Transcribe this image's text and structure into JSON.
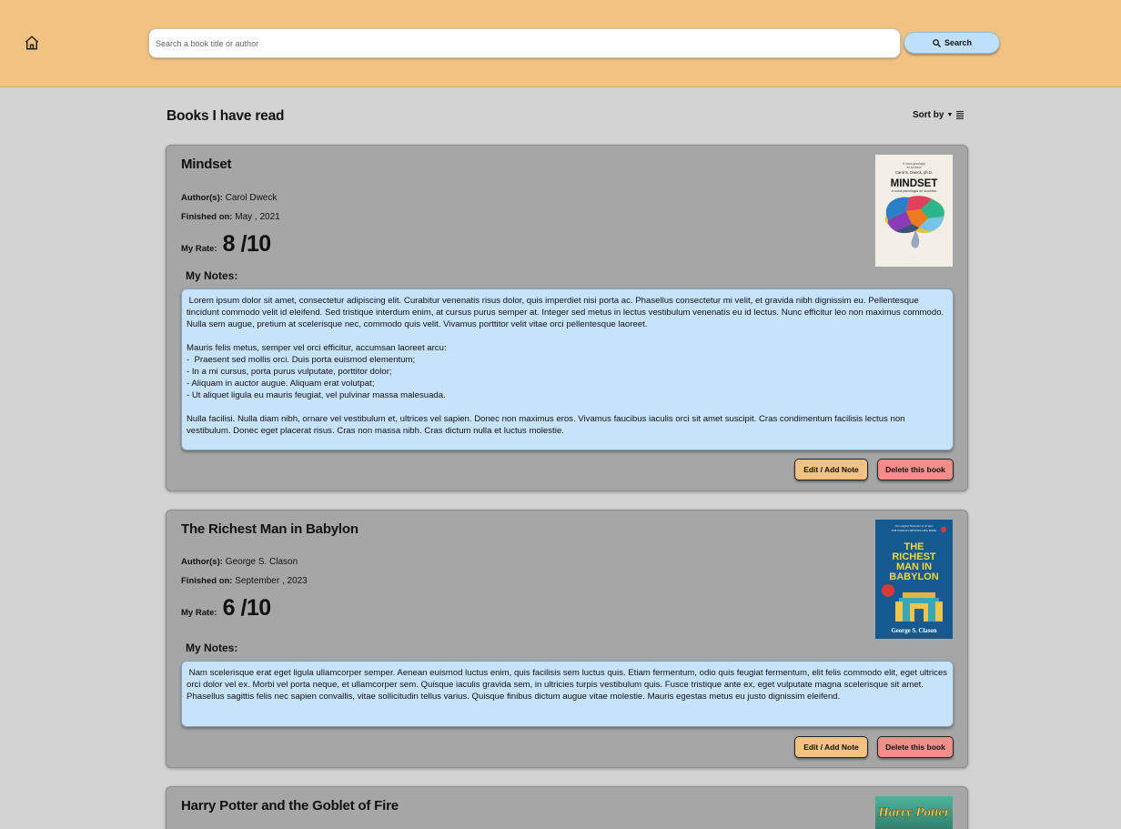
{
  "header": {
    "home_icon": "home-icon",
    "search_placeholder": "Search a book title or author",
    "search_label": "Search",
    "search_icon": "magnifier-icon"
  },
  "main": {
    "title": "Books I have read",
    "sort_label": "Sort by",
    "sort_icon": "sort-list-icon"
  },
  "labels": {
    "author": "Author(s):",
    "finished": "Finished on:",
    "rate": "My Rate:",
    "notes": "My Notes:",
    "edit": "Edit / Add Note",
    "delete": "Delete this book"
  },
  "books": [
    {
      "title": "Mindset",
      "author": "Carol Dweck",
      "finished": "May , 2021",
      "rate": "8 /10",
      "notes": " Lorem ipsum dolor sit amet, consectetur adipiscing elit. Curabitur venenatis risus dolor, quis imperdiet nisi porta ac. Phasellus consectetur mi velit, et gravida nibh dignissim eu. Pellentesque tincidunt commodo velit id eleifend. Sed tristique interdum enim, at cursus purus semper at. Integer sed metus in lectus vestibulum venenatis eu id lectus. Nunc efficitur leo non maximus commodo. Nulla sem augue, pretium at scelerisque nec, commodo quis velit. Vivamus porttitor velit vitae orci pellentesque laoreet.\n\nMauris felis metus, semper vel orci efficitur, accumsan laoreet arcu:\n-  Praesent sed mollis orci. Duis porta euismod elementum;\n- In a mi cursus, porta purus vulputate, porttitor dolor;\n- Aliquam in auctor augue. Aliquam erat volutpat;\n- Ut aliquet ligula eu mauris feugiat, vel pulvinar massa malesuada.\n\nNulla facilisi. Nulla diam nibh, ornare vel vestibulum et, ultrices vel sapien. Donec non maximus eros. Vivamus faucibus iaculis orci sit amet suscipit. Cras condimentum facilisis lectus non vestibulum. Donec eget placerat risus. Cras non massa nibh. Cras dictum nulla et luctus molestie.",
      "cover": {
        "tagline1": "A nova psicologia",
        "tagline2": "do sucesso",
        "author": "Carol S. Dweck, ph.D.",
        "title": "MINDSET",
        "subtitle": "A nova psicologia do sucesso",
        "bg": "#f3efe6"
      }
    },
    {
      "title": "The Richest Man in Babylon",
      "author": "George S. Clason",
      "finished": "September , 2023",
      "rate": "6 /10",
      "notes": " Nam scelerisque erat eget ligula ullamcorper semper. Aenean euismod luctus enim, quis facilisis sem luctus quis. Etiam fermentum, odio quis feugiat fermentum, elit felis commodo elit, eget ultrices orci dolor vel ex. Morbi vel porta neque, et ullamcorper sem. Quisque iaculis gravida sem, in ultricies turpis vestibulum quis. Fusce tristique ante ex, eget vulputate magna scelerisque sit amet. Phasellus sagittis felis nec sapien convallis, vitae sollicitudin tellus varius. Quisque finibus dictum augue vitae molestie. Mauris egestas metus eu justo dignissim eleifend.",
      "cover": {
        "tagline1": "The original Bestseller of all time",
        "tagline2": "THE WORLD'S BESTSELLING BOOK",
        "title_lines": [
          "THE",
          "RICHEST",
          "MAN IN",
          "BABYLON"
        ],
        "author": "George S. Clason",
        "bg": "#14598f",
        "title_color": "#f2d83b"
      }
    },
    {
      "title": "Harry Potter and the Goblet of Fire",
      "cover": {
        "title": "Harry Potter",
        "bg": "#2f8a72"
      }
    }
  ]
}
